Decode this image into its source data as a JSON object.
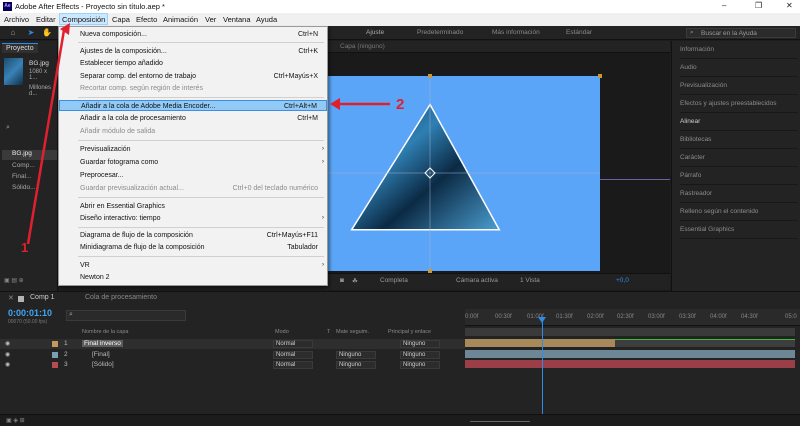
{
  "window": {
    "title": "Adobe After Effects - Proyecto sin título.aep *",
    "logo_text": "Ae",
    "controls": [
      "–",
      "❐",
      "✕"
    ]
  },
  "menubar": [
    "Archivo",
    "Editar",
    "Composición",
    "Capa",
    "Efecto",
    "Animación",
    "Ver",
    "Ventana",
    "Ayuda"
  ],
  "toolbar": {
    "workspaces": [
      "Predeterminado",
      "Más información",
      "Estándar"
    ],
    "help_placeholder": "Buscar en la Ayuda",
    "fit_label": "Ajuste"
  },
  "project": {
    "tab": "Proyecto",
    "file_name": "BG.jpg",
    "file_info": "1080 x 1...",
    "file_colors": "Millones d...",
    "items": [
      "BG.jpg",
      "Comp...",
      "Final...",
      "Sólido..."
    ]
  },
  "viewer": {
    "tab": "Composición",
    "layer_tab": "Capa (ninguno)",
    "quality": "Completa",
    "camera": "Cámara activa",
    "views": "1 Vista",
    "exposure": "+0,0"
  },
  "menu": {
    "items": [
      {
        "label": "Nueva composición...",
        "shortcut": "Ctrl+N",
        "disabled": false
      },
      {
        "label": "Ajustes de la composición...",
        "shortcut": "Ctrl+K",
        "disabled": false
      },
      {
        "label": "Establecer tiempo añadido",
        "shortcut": "",
        "disabled": false
      },
      {
        "label": "Separar comp. del entorno de trabajo",
        "shortcut": "Ctrl+Mayús+X",
        "disabled": false
      },
      {
        "label": "Recortar comp. según región de interés",
        "shortcut": "",
        "disabled": true
      },
      {
        "label": "Añadir a la cola de Adobe Media Encoder...",
        "shortcut": "Ctrl+Alt+M",
        "disabled": false
      },
      {
        "label": "Añadir a la cola de procesamiento",
        "shortcut": "Ctrl+M",
        "disabled": false
      },
      {
        "label": "Añadir módulo de salida",
        "shortcut": "",
        "disabled": true
      },
      {
        "label": "Previsualización",
        "shortcut": "",
        "disabled": false
      },
      {
        "label": "Guardar fotograma como",
        "shortcut": "",
        "disabled": false
      },
      {
        "label": "Preprocesar...",
        "shortcut": "",
        "disabled": false
      },
      {
        "label": "Guardar previsualización actual...",
        "shortcut": "Ctrl+0 del teclado numérico",
        "disabled": true
      },
      {
        "label": "Abrir en Essential Graphics",
        "shortcut": "",
        "disabled": false
      },
      {
        "label": "Diseño interactivo: tiempo",
        "shortcut": "",
        "disabled": false
      },
      {
        "label": "Diagrama de flujo de la composición",
        "shortcut": "Ctrl+Mayús+F11",
        "disabled": false
      },
      {
        "label": "Minidiagrama de flujo de la composición",
        "shortcut": "Tabulador",
        "disabled": false
      },
      {
        "label": "VR",
        "shortcut": "",
        "disabled": false
      },
      {
        "label": "Newton 2",
        "shortcut": "",
        "disabled": false
      }
    ],
    "submenu_arrow": "›"
  },
  "annotations": {
    "one": "1",
    "two": "2"
  },
  "right_panel": {
    "items": [
      "Información",
      "Audio",
      "Previsualización",
      "Efectos y ajustes preestablecidos",
      "Alinear",
      "Bibliotecas",
      "Carácter",
      "Párrafo",
      "Rastreador",
      "Relleno según el contenido",
      "Essential Graphics"
    ]
  },
  "timeline": {
    "tabs": [
      "Comp 1",
      "Cola de procesamiento"
    ],
    "timecode": "0:00:01:10",
    "frame_info": "00070 (50.00 fps)",
    "headers": {
      "name": "Nombre de la capa",
      "mode": "Modo",
      "t": "T",
      "matte": "Mate seguim.",
      "parent": "Principal y enlace"
    },
    "layers": [
      {
        "num": "1",
        "name": "Final inverso",
        "mode": "Normal",
        "matte": "",
        "parent": "Ninguno",
        "color": "#c39a5c"
      },
      {
        "num": "2",
        "name": "[Final]",
        "mode": "Normal",
        "matte": "Ninguno",
        "parent": "Ninguno",
        "color": "#7a9fb3"
      },
      {
        "num": "3",
        "name": "[Sólido]",
        "mode": "Normal",
        "matte": "Ninguno",
        "parent": "Ninguno",
        "color": "#b84a52"
      }
    ],
    "ruler": [
      "0:00f",
      "00:30f",
      "01:00f",
      "01:30f",
      "02:00f",
      "02:30f",
      "03:00f",
      "03:30f",
      "04:00f",
      "04:30f",
      "05:0"
    ]
  }
}
